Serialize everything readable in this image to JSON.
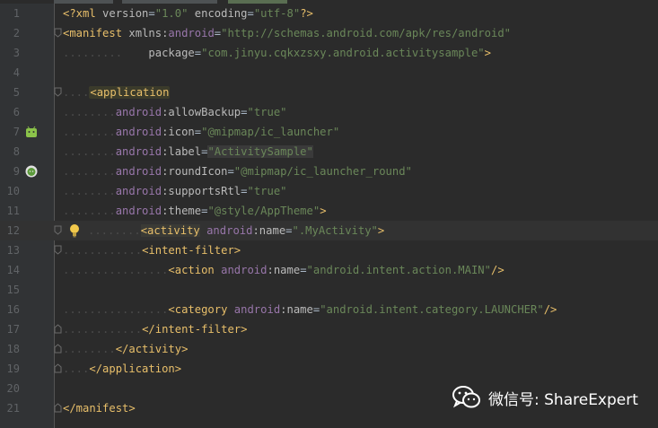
{
  "editor": {
    "lines": [
      {
        "n": "1",
        "html": "<span class=\"xmldecl\">&lt;?xml</span> <span class=\"attr\">version</span><span class=\"pun\">=</span><span class=\"str\">\"1.0\"</span> <span class=\"attr\">encoding</span><span class=\"pun\">=</span><span class=\"str\">\"utf-8\"</span><span class=\"xmldecl\">?&gt;</span>"
      },
      {
        "n": "2",
        "html": "<span class=\"tag\">&lt;manifest</span> <span class=\"attr\">xmlns:</span><span class=\"ns\">android</span><span class=\"pun\">=</span><span class=\"str\">\"http://schemas.android.com/apk/res/android\"</span>"
      },
      {
        "n": "3",
        "html": "<span class=\"dots\">.........</span>    <span class=\"attr\">package</span><span class=\"pun\">=</span><span class=\"str\">\"com.jinyu.cqkxzsxy.android.activitysample\"</span><span class=\"tag\">&gt;</span>"
      },
      {
        "n": "4",
        "html": ""
      },
      {
        "n": "5",
        "html": "<span class=\"dots\">....</span><span class=\"tag-app\">&lt;application</span>"
      },
      {
        "n": "6",
        "html": "<span class=\"dots\">........</span><span class=\"ns\">android</span><span class=\"attr\">:allowBackup</span><span class=\"pun\">=</span><span class=\"str\">\"true\"</span>"
      },
      {
        "n": "7",
        "html": "<span class=\"dots\">........</span><span class=\"ns\">android</span><span class=\"attr\">:icon</span><span class=\"pun\">=</span><span class=\"str\">\"@mipmap/ic_launcher\"</span>"
      },
      {
        "n": "8",
        "html": "<span class=\"dots\">........</span><span class=\"ns\">android</span><span class=\"attr\">:label</span><span class=\"pun\">=</span><span class=\"strhl\">\"ActivitySample\"</span>"
      },
      {
        "n": "9",
        "html": "<span class=\"dots\">........</span><span class=\"ns\">android</span><span class=\"attr\">:roundIcon</span><span class=\"pun\">=</span><span class=\"str\">\"@mipmap/ic_launcher_round\"</span>"
      },
      {
        "n": "10",
        "html": "<span class=\"dots\">........</span><span class=\"ns\">android</span><span class=\"attr\">:supportsRtl</span><span class=\"pun\">=</span><span class=\"str\">\"true\"</span>"
      },
      {
        "n": "11",
        "html": "<span class=\"dots\">........</span><span class=\"ns\">android</span><span class=\"attr\">:theme</span><span class=\"pun\">=</span><span class=\"str\">\"@style/AppTheme\"</span><span class=\"tag\">&gt;</span>"
      },
      {
        "n": "12",
        "html": "<span class=\"dots\">........</span><span class=\"tag-act\">&lt;activity</span> <span class=\"ns\">android</span><span class=\"attr\">:name</span><span class=\"pun\">=</span><span class=\"str\">\".MyActivity\"</span><span class=\"tag\">&gt;</span>"
      },
      {
        "n": "13",
        "html": "<span class=\"dots\">............</span><span class=\"tag\">&lt;intent-filter&gt;</span>"
      },
      {
        "n": "14",
        "html": "<span class=\"dots\">................</span><span class=\"tag\">&lt;action</span> <span class=\"ns\">android</span><span class=\"attr\">:name</span><span class=\"pun\">=</span><span class=\"str\">\"android.intent.action.MAIN\"</span><span class=\"tag\">/&gt;</span>"
      },
      {
        "n": "15",
        "html": ""
      },
      {
        "n": "16",
        "html": "<span class=\"dots\">................</span><span class=\"tag\">&lt;category</span> <span class=\"ns\">android</span><span class=\"attr\">:name</span><span class=\"pun\">=</span><span class=\"str\">\"android.intent.category.LAUNCHER\"</span><span class=\"tag\">/&gt;</span>"
      },
      {
        "n": "17",
        "html": "<span class=\"dots\">............</span><span class=\"tag\">&lt;/intent-filter&gt;</span>"
      },
      {
        "n": "18",
        "html": "<span class=\"dots\">........</span><span class=\"tag\">&lt;/activity&gt;</span>"
      },
      {
        "n": "19",
        "html": "<span class=\"dots\">....</span><span class=\"tag\">&lt;/application&gt;</span>"
      },
      {
        "n": "20",
        "html": ""
      },
      {
        "n": "21",
        "html": "<span class=\"tag\">&lt;/manifest&gt;</span>"
      }
    ]
  },
  "gutter_icons": {
    "line7": "android-robot-icon",
    "line9": "android-round-icon",
    "line12": "lightbulb-icon"
  },
  "watermark": {
    "label": "微信号: ShareExpert",
    "icon": "wechat-icon"
  },
  "colors": {
    "background": "#2b2b2b",
    "gutter": "#313335",
    "tag": "#e8bf6a",
    "string": "#6a8759",
    "namespace": "#9876aa"
  }
}
